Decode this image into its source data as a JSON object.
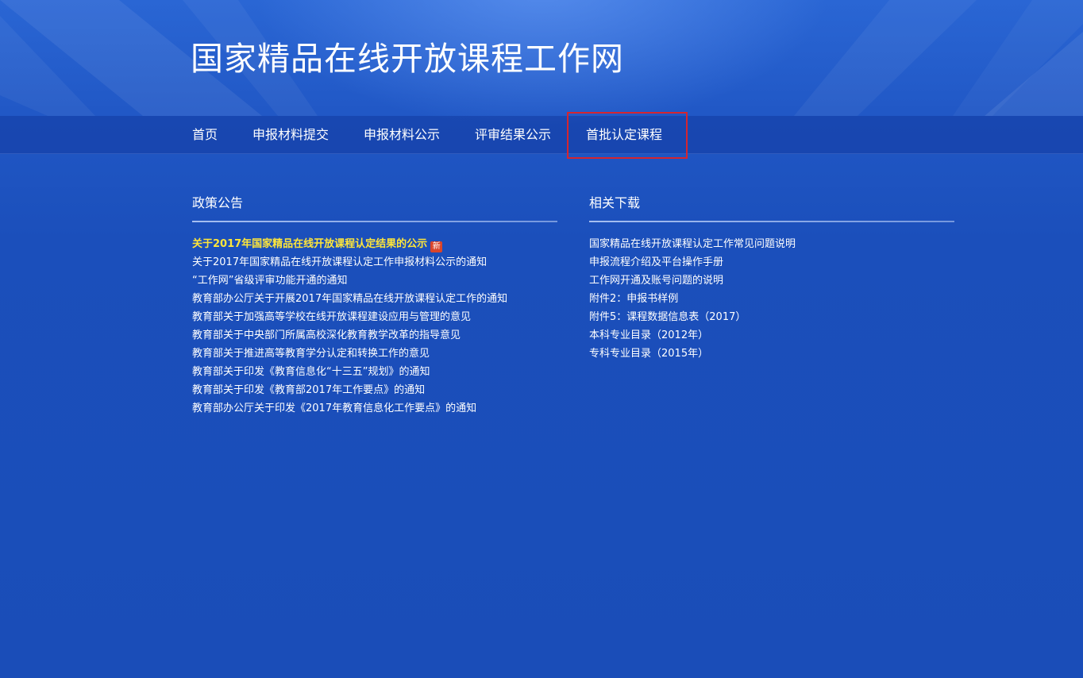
{
  "header": {
    "site_title": "国家精品在线开放课程工作网"
  },
  "nav": {
    "items": [
      {
        "label": "首页"
      },
      {
        "label": "申报材料提交"
      },
      {
        "label": "申报材料公示"
      },
      {
        "label": "评审结果公示"
      },
      {
        "label": "首批认定课程"
      }
    ],
    "highlighted_item": "首批认定课程",
    "highlight_color": "#d6252f"
  },
  "policy": {
    "heading": "政策公告",
    "items": [
      {
        "text": "关于2017年国家精品在线开放课程认定结果的公示",
        "badge": "新"
      },
      {
        "text": "关于2017年国家精品在线开放课程认定工作申报材料公示的通知"
      },
      {
        "text": "“工作网”省级评审功能开通的通知"
      },
      {
        "text": "教育部办公厅关于开展2017年国家精品在线开放课程认定工作的通知"
      },
      {
        "text": "教育部关于加强高等学校在线开放课程建设应用与管理的意见"
      },
      {
        "text": "教育部关于中央部门所属高校深化教育教学改革的指导意见"
      },
      {
        "text": "教育部关于推进高等教育学分认定和转换工作的意见"
      },
      {
        "text": "教育部关于印发《教育信息化“十三五”规划》的通知"
      },
      {
        "text": "教育部关于印发《教育部2017年工作要点》的通知"
      },
      {
        "text": "教育部办公厅关于印发《2017年教育信息化工作要点》的通知"
      }
    ]
  },
  "downloads": {
    "heading": "相关下载",
    "items": [
      {
        "text": "国家精品在线开放课程认定工作常见问题说明"
      },
      {
        "text": "申报流程介绍及平台操作手册"
      },
      {
        "text": "工作网开通及账号问题的说明"
      },
      {
        "text": "附件2：申报书样例"
      },
      {
        "text": "附件5：课程数据信息表（2017）"
      },
      {
        "text": "本科专业目录（2012年）"
      },
      {
        "text": "专科专业目录（2015年）"
      }
    ]
  },
  "colors": {
    "background": "#1f53bf",
    "featured_link": "#ffe63a",
    "badge": "#d9452b",
    "text": "#ffffff"
  }
}
